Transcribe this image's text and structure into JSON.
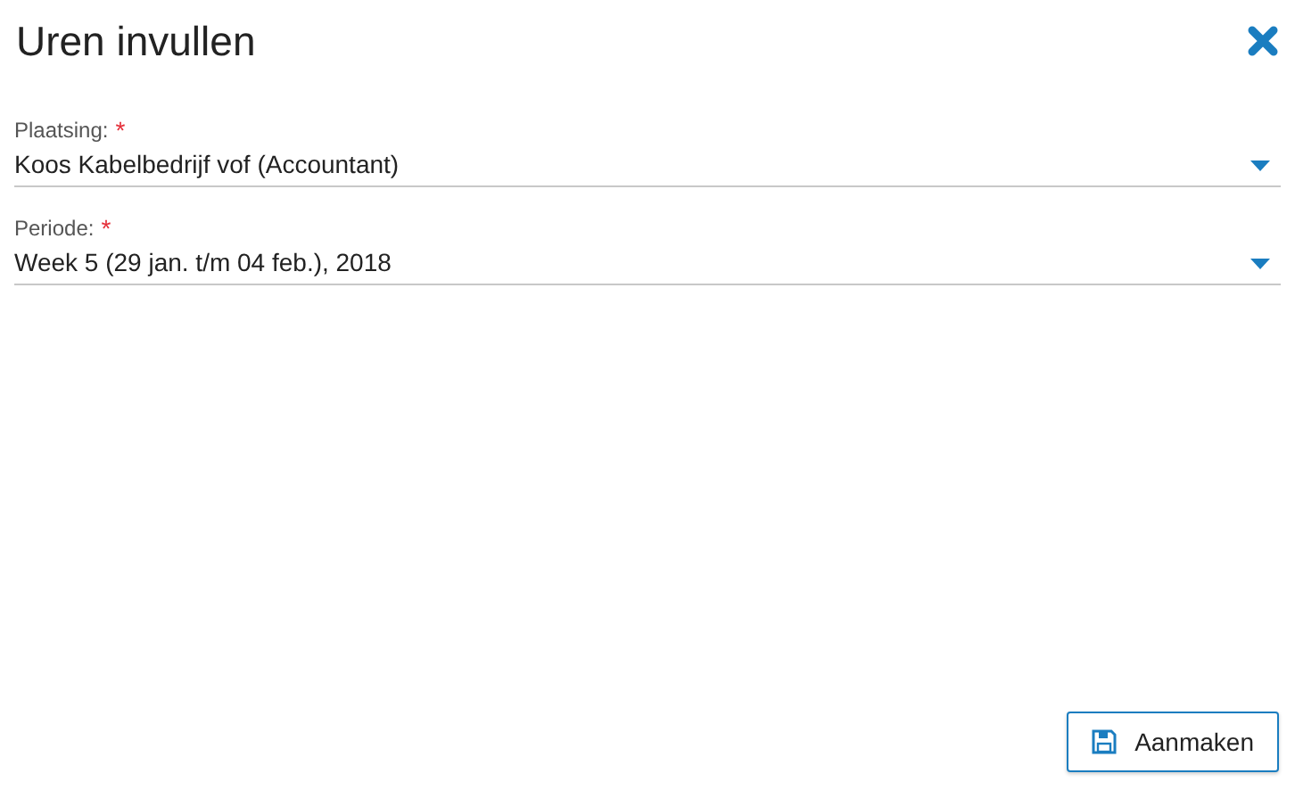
{
  "dialog": {
    "title": "Uren invullen"
  },
  "fields": [
    {
      "label": "Plaatsing:",
      "required_mark": "*",
      "value": "Koos Kabelbedrijf vof (Accountant)"
    },
    {
      "label": "Periode:",
      "required_mark": "*",
      "value": "Week 5 (29 jan. t/m 04 feb.), 2018"
    }
  ],
  "buttons": [
    {
      "label": "Aanmaken"
    }
  ]
}
